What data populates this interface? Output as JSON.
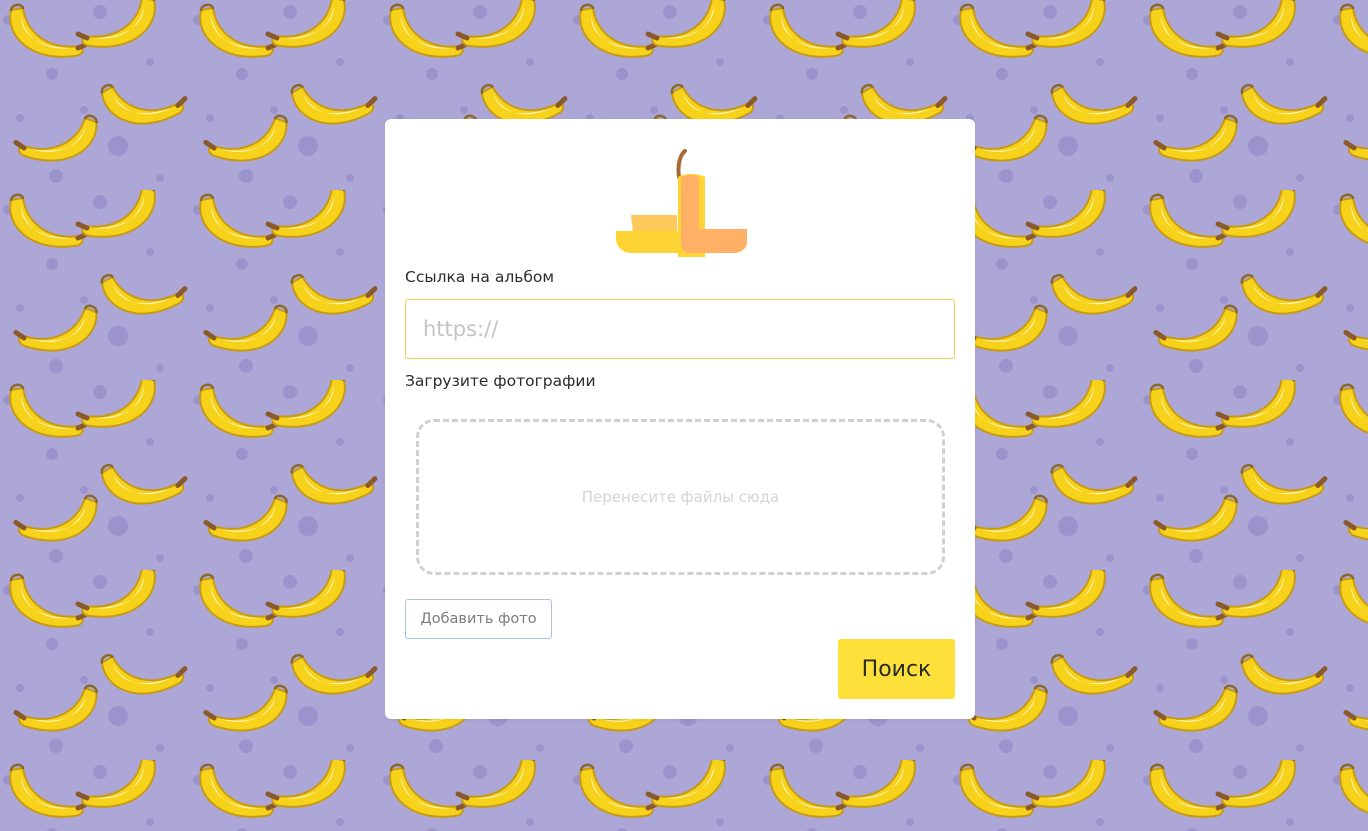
{
  "background": {
    "color": "#ada7d8",
    "pattern": "banana-pattern"
  },
  "logo": {
    "icon": "banana-peel-logo"
  },
  "form": {
    "album_link_label": "Ссылка на альбом",
    "url_placeholder": "https://",
    "upload_label": "Загрузите фотографии",
    "dropzone_text": "Перенесите файлы сюда",
    "add_photo_label": "Добавить фото",
    "search_label": "Поиск"
  },
  "colors": {
    "accent": "#fde13a",
    "input_border": "#e6d552",
    "secondary_button_border": "#a8c4dc"
  }
}
